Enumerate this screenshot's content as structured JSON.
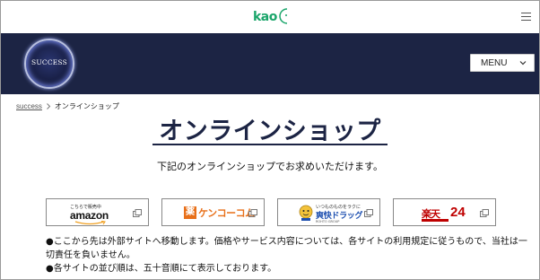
{
  "header": {
    "logo_text": "kao",
    "menu_icon": "hamburger-icon"
  },
  "banner": {
    "badge_text": "SUCCESS",
    "menu_label": "MENU",
    "menu_icon": "chevron-down-icon"
  },
  "breadcrumb": {
    "home": "success",
    "current": "オンラインショップ"
  },
  "main": {
    "title": "オンラインショップ",
    "subtitle": "下記のオンラインショップでお求めいただけます。"
  },
  "shops": [
    {
      "name": "amazon",
      "tagline": "こちらで販売中",
      "logo_text": "amazon"
    },
    {
      "name": "kenko-com",
      "mark": "薬",
      "logo_text": "ケンコーコム"
    },
    {
      "name": "kaiteki-drug",
      "top_text": "いつものものをラクに",
      "logo_text": "爽快ドラッグ",
      "bottom_text": "ROHTO GROUP"
    },
    {
      "name": "rakuten24",
      "mark": "楽天",
      "logo_text": "24"
    }
  ],
  "notes": [
    "●ここから先は外部サイトへ移動します。価格やサービス内容については、各サイトの利用規定に従うもので、当社は一切責任を負いません。",
    "●各サイトの並び順は、五十音順にて表示しております。"
  ],
  "colors": {
    "navy": "#1c2444",
    "kao_green": "#1aa56a",
    "kenko_orange": "#e8701a",
    "kaiteki_blue": "#1d4fb0",
    "rakuten_red": "#bf0000"
  }
}
